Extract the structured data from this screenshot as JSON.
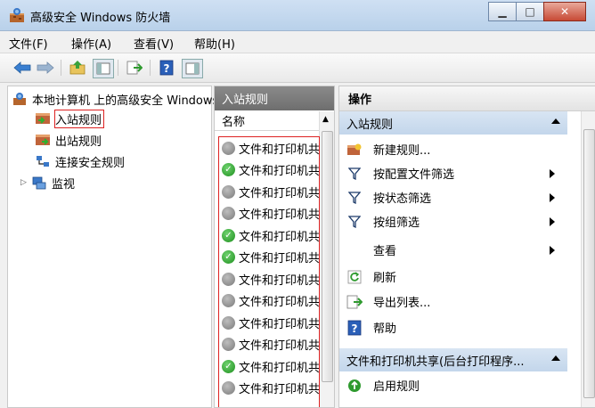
{
  "window": {
    "title": "高级安全 Windows 防火墙",
    "minimize_glyph": "▁",
    "maximize_glyph": "□",
    "close_glyph": "✕"
  },
  "menubar": {
    "items": [
      "文件(F)",
      "操作(A)",
      "查看(V)",
      "帮助(H)"
    ]
  },
  "toolbar": {
    "icons": [
      "back-arrow-icon",
      "forward-arrow-icon",
      "folder-up-icon",
      "console-tree-icon",
      "export-list-icon",
      "help-icon",
      "action-pane-icon"
    ]
  },
  "tree": {
    "root": "本地计算机 上的高级安全 Windows",
    "items": [
      {
        "label": "入站规则",
        "selected": true
      },
      {
        "label": "出站规则",
        "selected": false
      },
      {
        "label": "连接安全规则",
        "selected": false
      },
      {
        "label": "监视",
        "selected": false
      }
    ]
  },
  "middle": {
    "header": "入站规则",
    "column_name": "名称",
    "rows": [
      {
        "name": "文件和打印机共享",
        "enabled": false
      },
      {
        "name": "文件和打印机共享",
        "enabled": true
      },
      {
        "name": "文件和打印机共享",
        "enabled": false
      },
      {
        "name": "文件和打印机共享",
        "enabled": false
      },
      {
        "name": "文件和打印机共享",
        "enabled": true
      },
      {
        "name": "文件和打印机共享",
        "enabled": true
      },
      {
        "name": "文件和打印机共享",
        "enabled": false
      },
      {
        "name": "文件和打印机共享",
        "enabled": false
      },
      {
        "name": "文件和打印机共享",
        "enabled": false
      },
      {
        "name": "文件和打印机共享",
        "enabled": false
      },
      {
        "name": "文件和打印机共享",
        "enabled": true
      },
      {
        "name": "文件和打印机共享",
        "enabled": false
      }
    ]
  },
  "actions": {
    "header": "操作",
    "section1": "入站规则",
    "items": [
      {
        "label": "新建规则...",
        "submenu": false
      },
      {
        "label": "按配置文件筛选",
        "submenu": true
      },
      {
        "label": "按状态筛选",
        "submenu": true
      },
      {
        "label": "按组筛选",
        "submenu": true
      },
      {
        "label": "查看",
        "submenu": true
      },
      {
        "label": "刷新",
        "submenu": false
      },
      {
        "label": "导出列表...",
        "submenu": false
      },
      {
        "label": "帮助",
        "submenu": false
      }
    ],
    "section2": "文件和打印机共享(后台打印程序...",
    "section2_items": [
      {
        "label": "启用规则"
      }
    ]
  },
  "colors": {
    "title_bar": "#b9d1ea",
    "selection_outline": "#dd2222",
    "enabled_green": "#1f8f1f",
    "disabled_gray": "#7a7a7a",
    "section_blue": "#c3d6eb"
  }
}
